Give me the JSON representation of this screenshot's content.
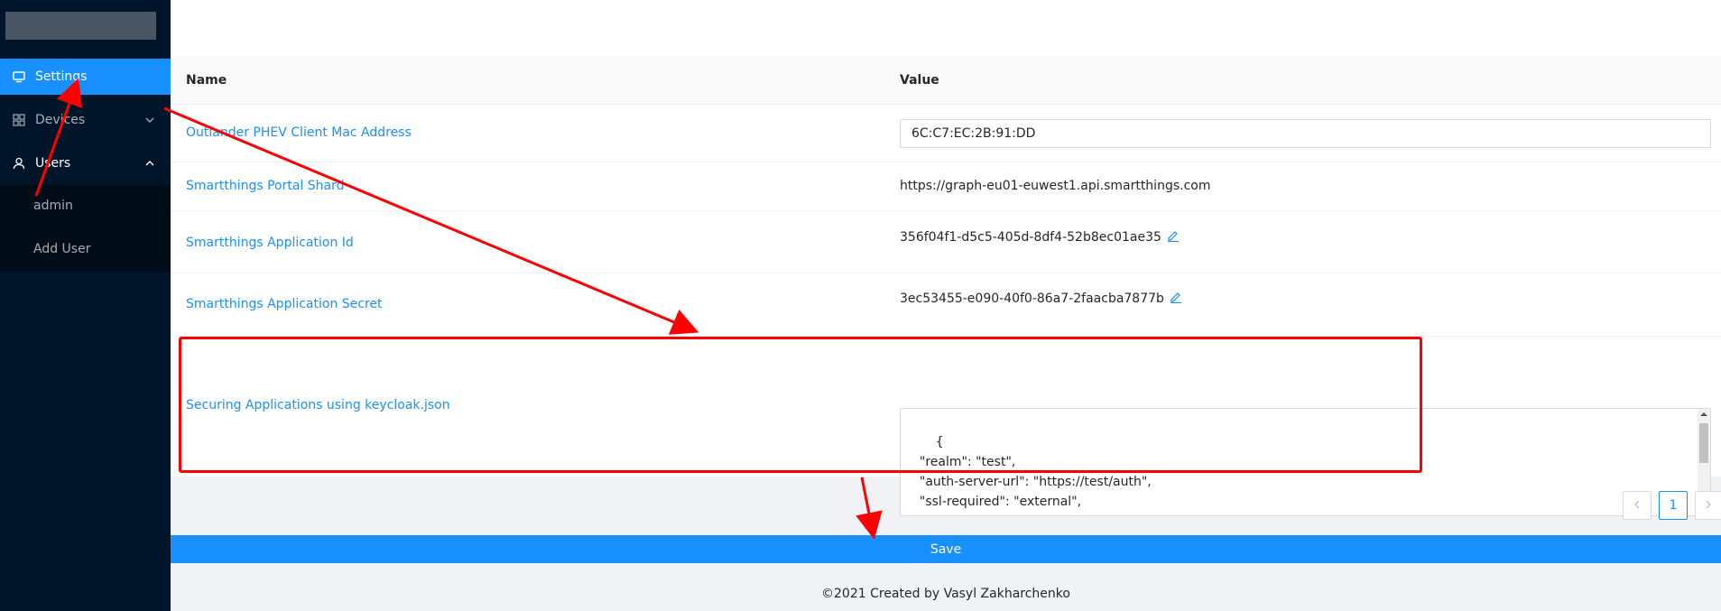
{
  "sidebar": {
    "items": [
      {
        "label": "Settings",
        "icon": "monitor-icon",
        "selected": true
      },
      {
        "label": "Devices",
        "icon": "grid-icon",
        "expandable": true
      },
      {
        "label": "Users",
        "icon": "user-icon",
        "expandable": true,
        "expanded": true
      }
    ],
    "submenu": [
      {
        "label": "admin"
      },
      {
        "label": "Add User"
      }
    ]
  },
  "table": {
    "columns": {
      "name": "Name",
      "value": "Value"
    },
    "rows": [
      {
        "name": "Outlander PHEV Client Mac Address",
        "value": "6C:C7:EC:2B:91:DD",
        "kind": "input"
      },
      {
        "name": "Smartthings Portal Shard",
        "value": "https://graph-eu01-euwest1.api.smartthings.com",
        "kind": "text"
      },
      {
        "name": "Smartthings Application Id",
        "value": "356f04f1-d5c5-405d-8df4-52b8ec01ae35",
        "kind": "editable"
      },
      {
        "name": "Smartthings Application Secret",
        "value": "3ec53455-e090-40f0-86a7-2faacba7877b",
        "kind": "editable"
      },
      {
        "name": "Securing Applications using keycloak.json",
        "value": "{\n  \"realm\": \"test\",\n  \"auth-server-url\": \"https://test/auth\",\n  \"ssl-required\": \"external\",\n  \"resource\": \"test\",",
        "kind": "textarea"
      }
    ]
  },
  "pagination": {
    "current": "1",
    "prev_icon": "chevron-left-icon",
    "next_icon": "chevron-right-icon"
  },
  "save_label": "Save",
  "footer": "©2021 Created by Vasyl Zakharchenko",
  "colors": {
    "primary": "#1890ff",
    "sider": "#001529",
    "annotation": "#ff0000"
  }
}
